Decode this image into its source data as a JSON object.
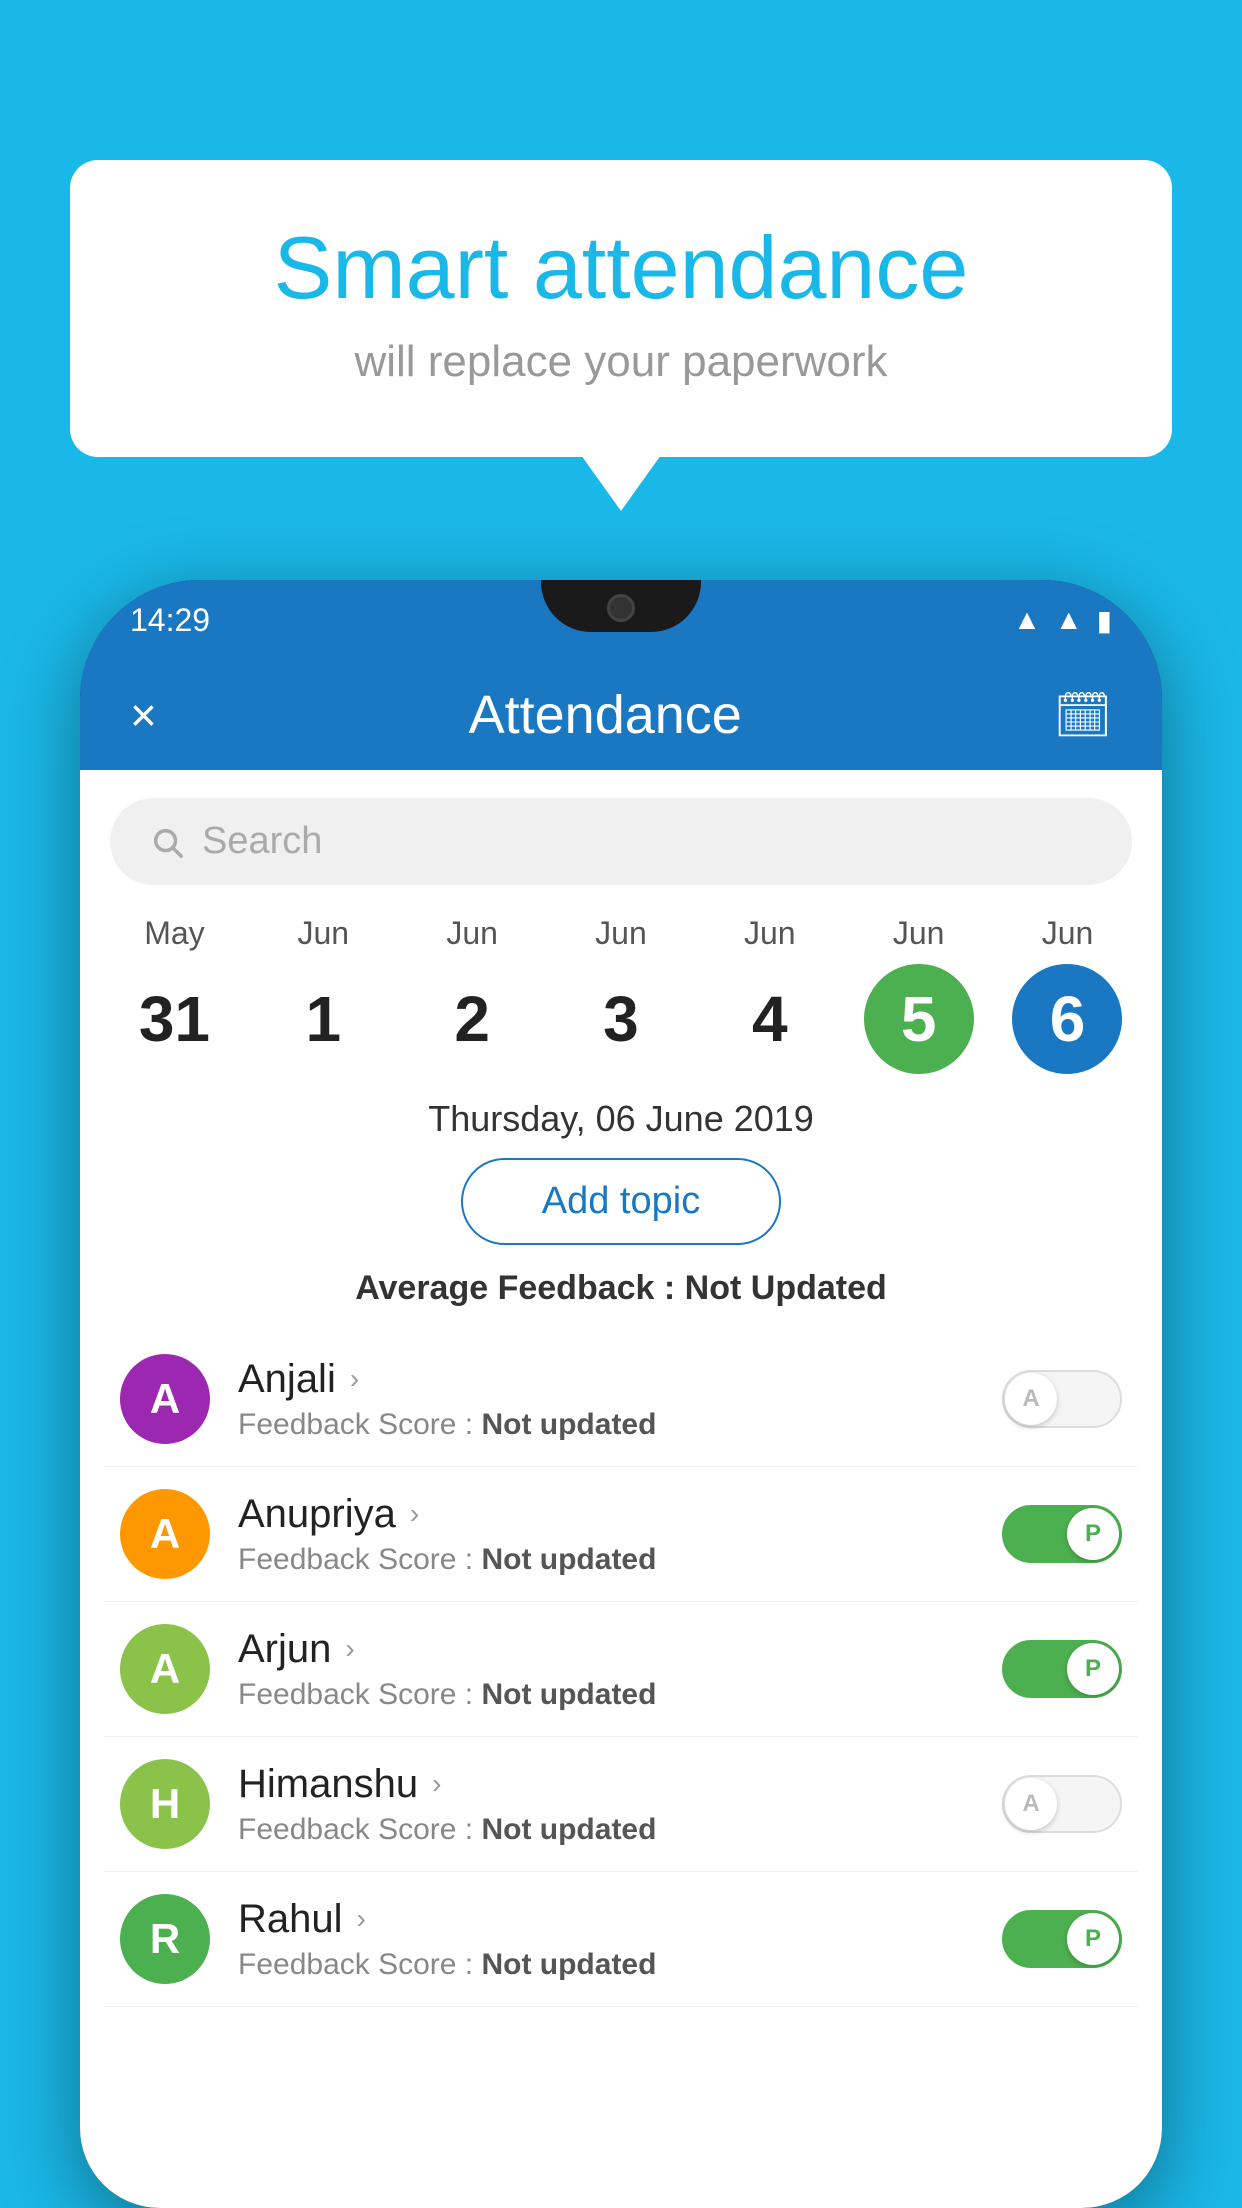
{
  "background_color": "#1ab8e8",
  "speech_bubble": {
    "title": "Smart attendance",
    "subtitle": "will replace your paperwork"
  },
  "phone": {
    "status_bar": {
      "time": "14:29"
    },
    "app_header": {
      "title": "Attendance",
      "close_label": "×",
      "calendar_icon": "📅"
    },
    "search": {
      "placeholder": "Search"
    },
    "calendar": {
      "days": [
        {
          "month": "May",
          "day": "31",
          "type": "normal"
        },
        {
          "month": "Jun",
          "day": "1",
          "type": "normal"
        },
        {
          "month": "Jun",
          "day": "2",
          "type": "normal"
        },
        {
          "month": "Jun",
          "day": "3",
          "type": "normal"
        },
        {
          "month": "Jun",
          "day": "4",
          "type": "normal"
        },
        {
          "month": "Jun",
          "day": "5",
          "type": "today"
        },
        {
          "month": "Jun",
          "day": "6",
          "type": "selected"
        }
      ]
    },
    "selected_date": "Thursday, 06 June 2019",
    "add_topic_label": "Add topic",
    "average_feedback_label": "Average Feedback :",
    "average_feedback_value": "Not Updated",
    "students": [
      {
        "name": "Anjali",
        "avatar_letter": "A",
        "avatar_color": "#9c27b0",
        "score_label": "Feedback Score :",
        "score_value": "Not updated",
        "toggle": "off",
        "toggle_label": "A"
      },
      {
        "name": "Anupriya",
        "avatar_letter": "A",
        "avatar_color": "#ff9800",
        "score_label": "Feedback Score :",
        "score_value": "Not updated",
        "toggle": "on",
        "toggle_label": "P"
      },
      {
        "name": "Arjun",
        "avatar_letter": "A",
        "avatar_color": "#8bc34a",
        "score_label": "Feedback Score :",
        "score_value": "Not updated",
        "toggle": "on",
        "toggle_label": "P"
      },
      {
        "name": "Himanshu",
        "avatar_letter": "H",
        "avatar_color": "#8bc34a",
        "score_label": "Feedback Score :",
        "score_value": "Not updated",
        "toggle": "off",
        "toggle_label": "A"
      },
      {
        "name": "Rahul",
        "avatar_letter": "R",
        "avatar_color": "#4caf50",
        "score_label": "Feedback Score :",
        "score_value": "Not updated",
        "toggle": "on",
        "toggle_label": "P"
      }
    ]
  }
}
